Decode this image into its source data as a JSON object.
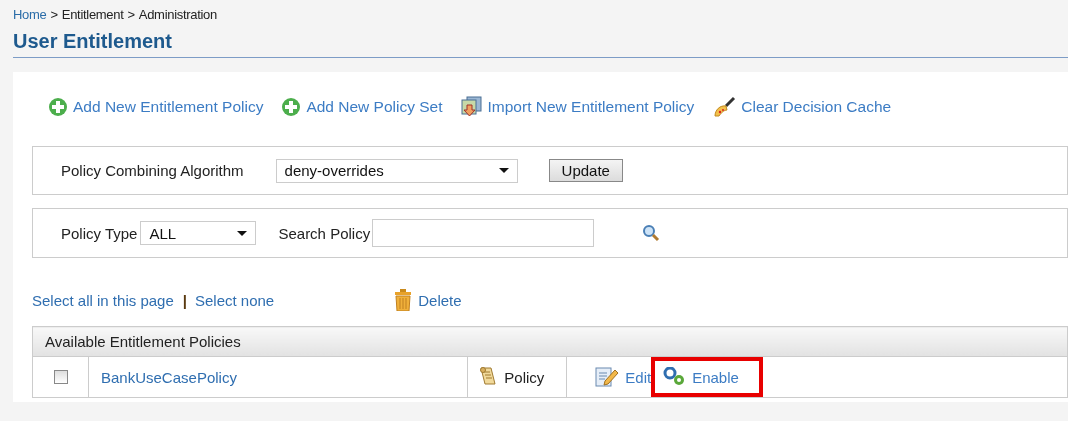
{
  "breadcrumb": [
    {
      "label": "Home",
      "kind": "link"
    },
    {
      "label": "Entitlement",
      "kind": "text"
    },
    {
      "label": "Administration",
      "kind": "text"
    }
  ],
  "breadcrumb_separator": ">",
  "title": "User Entitlement",
  "actions": [
    {
      "label": "Add New Entitlement Policy",
      "kind": "add"
    },
    {
      "label": "Add New Policy Set",
      "kind": "add"
    },
    {
      "label": "Import New Entitlement Policy",
      "kind": "import"
    },
    {
      "label": "Clear Decision Cache",
      "kind": "clear"
    }
  ],
  "algorithm": {
    "label": "Policy Combining Algorithm",
    "value": "deny-overrides",
    "button": "Update"
  },
  "filter": {
    "type_label": "Policy Type",
    "type_value": "ALL",
    "search_label": "Search Policy"
  },
  "selection": {
    "select_all": "Select all in this page",
    "separator": "|",
    "select_none": "Select none",
    "delete": "Delete"
  },
  "table": {
    "header": "Available Entitlement Policies",
    "rows": [
      {
        "checked": false,
        "name": "BankUseCasePolicy",
        "policy": "Policy",
        "edit": "Edit",
        "enable": "Enable",
        "enable_highlighted": true
      }
    ]
  }
}
